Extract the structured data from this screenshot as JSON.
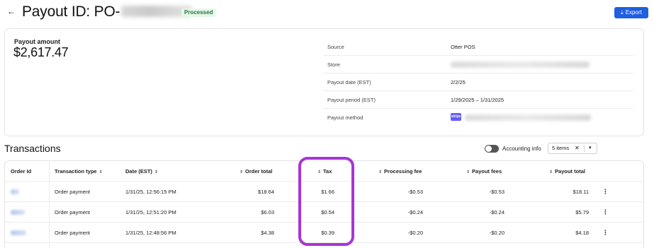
{
  "header": {
    "title": "Payout ID: PO-",
    "status": "Processed",
    "export_label": "Export"
  },
  "summary": {
    "amount_label": "Payout amount",
    "amount_value": "$2,617.47",
    "details": [
      {
        "label": "Source",
        "value": "Otter POS"
      },
      {
        "label": "Store",
        "value": ""
      },
      {
        "label": "Payout date (EST)",
        "value": "2/2/25"
      },
      {
        "label": "Payout period (EST)",
        "value": "1/29/2025 – 1/31/2025"
      },
      {
        "label": "Payout method",
        "value": "",
        "badge": "stripe"
      }
    ]
  },
  "transactions": {
    "title": "Transactions",
    "toggle_label": "Accounting info",
    "toggle_on": false,
    "filter_chip": "5 items",
    "columns": [
      {
        "label": "Order Id"
      },
      {
        "label": "Transaction type"
      },
      {
        "label": "Date (EST)"
      },
      {
        "label": "Order total"
      },
      {
        "label": "Tax"
      },
      {
        "label": "Processing fee"
      },
      {
        "label": "Payout fees"
      },
      {
        "label": "Payout total"
      }
    ],
    "rows": [
      {
        "type": "Order payment",
        "date": "1/31/25, 12:56:15 PM",
        "order_total": "$18.64",
        "tax": "$1.66",
        "processing_fee": "-$0.53",
        "payout_fees": "-$0.53",
        "payout_total": "$18.11"
      },
      {
        "type": "Order payment",
        "date": "1/31/25, 12:51:20 PM",
        "order_total": "$6.03",
        "tax": "$0.54",
        "processing_fee": "-$0.24",
        "payout_fees": "-$0.24",
        "payout_total": "$5.79"
      },
      {
        "type": "Order payment",
        "date": "1/31/25, 12:48:56 PM",
        "order_total": "$4.38",
        "tax": "$0.39",
        "processing_fee": "-$0.20",
        "payout_fees": "-$0.20",
        "payout_total": "$4.18"
      }
    ]
  },
  "colors": {
    "accent": "#1f5fe0",
    "highlight": "#a735d8",
    "status_bg": "#e7f6ea",
    "status_text": "#1f7a3a",
    "stripe": "#635bff"
  },
  "icons": {
    "back": "arrow-left-icon",
    "export": "download-icon",
    "sort": "sort-icon",
    "menu": "more-vertical-icon",
    "close": "close-icon",
    "caret": "chevron-down-icon"
  }
}
